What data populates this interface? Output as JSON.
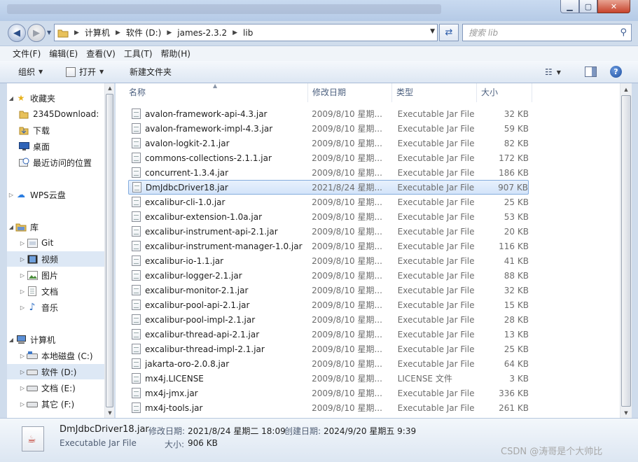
{
  "window": {
    "min_icon": "minimize-icon",
    "max_icon": "maximize-icon",
    "close_icon": "close-icon"
  },
  "address": {
    "crumbs": [
      "计算机",
      "软件 (D:)",
      "james-2.3.2",
      "lib"
    ],
    "search_placeholder": "搜索 lib"
  },
  "menu": [
    "文件(F)",
    "编辑(E)",
    "查看(V)",
    "工具(T)",
    "帮助(H)"
  ],
  "toolbar": {
    "organize": "组织",
    "open": "打开",
    "new_folder": "新建文件夹"
  },
  "nav": {
    "favorites": "收藏夹",
    "downloads_2345": "2345Download:",
    "downloads": "下载",
    "desktop": "桌面",
    "recent": "最近访问的位置",
    "wps": "WPS云盘",
    "libraries": "库",
    "git": "Git",
    "videos": "视频",
    "pictures": "图片",
    "documents": "文档",
    "music": "音乐",
    "computer": "计算机",
    "drive_c": "本地磁盘 (C:)",
    "drive_d": "软件 (D:)",
    "drive_e": "文档 (E:)",
    "drive_f": "其它 (F:)"
  },
  "columns": {
    "name": "名称",
    "date": "修改日期",
    "type": "类型",
    "size": "大小"
  },
  "files": [
    {
      "name": "avalon-framework-api-4.3.jar",
      "date": "2009/8/10 星期...",
      "type": "Executable Jar File",
      "size": "32 KB"
    },
    {
      "name": "avalon-framework-impl-4.3.jar",
      "date": "2009/8/10 星期...",
      "type": "Executable Jar File",
      "size": "59 KB"
    },
    {
      "name": "avalon-logkit-2.1.jar",
      "date": "2009/8/10 星期...",
      "type": "Executable Jar File",
      "size": "82 KB"
    },
    {
      "name": "commons-collections-2.1.1.jar",
      "date": "2009/8/10 星期...",
      "type": "Executable Jar File",
      "size": "172 KB"
    },
    {
      "name": "concurrent-1.3.4.jar",
      "date": "2009/8/10 星期...",
      "type": "Executable Jar File",
      "size": "186 KB"
    },
    {
      "name": "DmJdbcDriver18.jar",
      "date": "2021/8/24 星期...",
      "type": "Executable Jar File",
      "size": "907 KB"
    },
    {
      "name": "excalibur-cli-1.0.jar",
      "date": "2009/8/10 星期...",
      "type": "Executable Jar File",
      "size": "25 KB"
    },
    {
      "name": "excalibur-extension-1.0a.jar",
      "date": "2009/8/10 星期...",
      "type": "Executable Jar File",
      "size": "53 KB"
    },
    {
      "name": "excalibur-instrument-api-2.1.jar",
      "date": "2009/8/10 星期...",
      "type": "Executable Jar File",
      "size": "20 KB"
    },
    {
      "name": "excalibur-instrument-manager-1.0.jar",
      "date": "2009/8/10 星期...",
      "type": "Executable Jar File",
      "size": "116 KB"
    },
    {
      "name": "excalibur-io-1.1.jar",
      "date": "2009/8/10 星期...",
      "type": "Executable Jar File",
      "size": "41 KB"
    },
    {
      "name": "excalibur-logger-2.1.jar",
      "date": "2009/8/10 星期...",
      "type": "Executable Jar File",
      "size": "88 KB"
    },
    {
      "name": "excalibur-monitor-2.1.jar",
      "date": "2009/8/10 星期...",
      "type": "Executable Jar File",
      "size": "32 KB"
    },
    {
      "name": "excalibur-pool-api-2.1.jar",
      "date": "2009/8/10 星期...",
      "type": "Executable Jar File",
      "size": "15 KB"
    },
    {
      "name": "excalibur-pool-impl-2.1.jar",
      "date": "2009/8/10 星期...",
      "type": "Executable Jar File",
      "size": "28 KB"
    },
    {
      "name": "excalibur-thread-api-2.1.jar",
      "date": "2009/8/10 星期...",
      "type": "Executable Jar File",
      "size": "13 KB"
    },
    {
      "name": "excalibur-thread-impl-2.1.jar",
      "date": "2009/8/10 星期...",
      "type": "Executable Jar File",
      "size": "25 KB"
    },
    {
      "name": "jakarta-oro-2.0.8.jar",
      "date": "2009/8/10 星期...",
      "type": "Executable Jar File",
      "size": "64 KB"
    },
    {
      "name": "mx4j.LICENSE",
      "date": "2009/8/10 星期...",
      "type": "LICENSE 文件",
      "size": "3 KB"
    },
    {
      "name": "mx4j-jmx.jar",
      "date": "2009/8/10 星期...",
      "type": "Executable Jar File",
      "size": "336 KB"
    },
    {
      "name": "mx4j-tools.jar",
      "date": "2009/8/10 星期...",
      "type": "Executable Jar File",
      "size": "261 KB"
    }
  ],
  "selected_file_index": 5,
  "details": {
    "name": "DmJdbcDriver18.jar",
    "type": "Executable Jar File",
    "modified_label": "修改日期:",
    "modified": "2021/8/24 星期二 18:09",
    "created_label": "创建日期:",
    "created": "2024/9/20 星期五 9:39",
    "size_label": "大小:",
    "size": "906 KB"
  },
  "watermark": "CSDN @涛哥是个大帅比"
}
